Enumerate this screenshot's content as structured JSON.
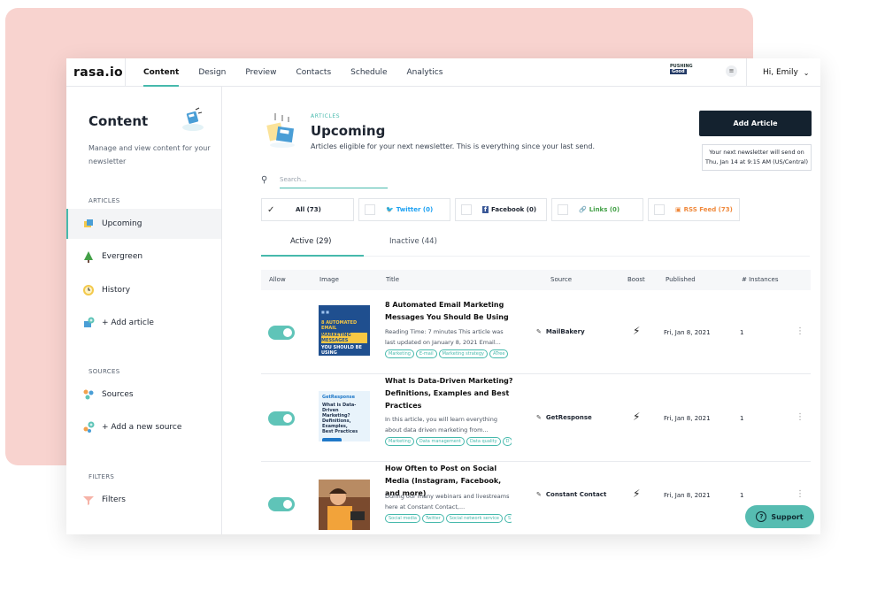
{
  "app": {
    "logo": "rasa.io",
    "nav": [
      "Content",
      "Design",
      "Preview",
      "Contacts",
      "Schedule",
      "Analytics"
    ],
    "active_nav": "Content",
    "brand_badge": {
      "line1": "PUSHING",
      "line2": "Good"
    },
    "menu_icon": "menu-dots-icon",
    "user_label": "Hi, Emily"
  },
  "sidebar": {
    "title": "Content",
    "description": "Manage and view content for your newsletter",
    "sections": {
      "articles": "ARTICLES",
      "sources": "SOURCES",
      "filters": "FILTERS"
    },
    "items": [
      {
        "label": "Upcoming",
        "icon": "upcoming-icon"
      },
      {
        "label": "Evergreen",
        "icon": "tree-icon"
      },
      {
        "label": "History",
        "icon": "history-icon"
      },
      {
        "label": "+ Add article",
        "icon": "add-article-icon"
      },
      {
        "label": "Sources",
        "icon": "sources-icon"
      },
      {
        "label": "+ Add a new source",
        "icon": "add-source-icon"
      },
      {
        "label": "Filters",
        "icon": "filter-icon"
      }
    ]
  },
  "main": {
    "eyebrow": "ARTICLES",
    "title": "Upcoming",
    "subtitle": "Articles eligible for your next newsletter. This is everything since your last send.",
    "add_button": "Add Article",
    "next_note_line1": "Your next newsletter will send on",
    "next_note_line2": "Thu, Jan 14 at 9:15 AM (US/Central)",
    "search_placeholder": "Search...",
    "channels": [
      {
        "label": "All (73)",
        "icon": "check-icon"
      },
      {
        "label": "Twitter (0)",
        "icon": "twitter-icon"
      },
      {
        "label": "Facebook (0)",
        "icon": "facebook-icon"
      },
      {
        "label": "Links (0)",
        "icon": "link-icon"
      },
      {
        "label": "RSS Feed (73)",
        "icon": "rss-icon"
      }
    ],
    "tabs": {
      "active": "Active (29)",
      "inactive": "Inactive (44)"
    },
    "columns": [
      "Allow",
      "Image",
      "Title",
      "Source",
      "Boost",
      "Published",
      "# Instances"
    ],
    "rows": [
      {
        "title": "8 Automated Email Marketing Messages You Should Be Using",
        "desc": "Reading Time: 7 minutes This article was last updated on January 8, 2021 Email...",
        "tags": [
          "Marketing",
          "E-mail",
          "Marketing strategy",
          "ATree"
        ],
        "source": "MailBakery",
        "published": "Fri, Jan 8, 2021",
        "instances": "1",
        "thumb_lines": [
          "8 AUTOMATED EMAIL",
          "MARKETING MESSAGES",
          "YOU SHOULD BE USING"
        ]
      },
      {
        "title": "What Is Data-Driven Marketing? Definitions, Examples and Best Practices",
        "desc": "In this article, you will learn everything about data driven marketing from...",
        "tags": [
          "Marketing",
          "Data management",
          "Data quality",
          "D"
        ],
        "source": "GetResponse",
        "published": "Fri, Jan 8, 2021",
        "instances": "1",
        "thumb_lines": [
          "GetResponse",
          "What is Data-Driven",
          "Marketing?",
          "Definitions, Examples,",
          "Best Practices"
        ]
      },
      {
        "title": "How Often to Post on Social Media (Instagram, Facebook, and more)",
        "desc": "During our many webinars and livestreams here at Constant Contact,...",
        "tags": [
          "Social media",
          "Twitter",
          "Social network service",
          "S"
        ],
        "source": "Constant Contact",
        "published": "Fri, Jan 8, 2021",
        "instances": "1",
        "thumb_lines": []
      }
    ]
  },
  "support": {
    "label": "Support"
  },
  "colors": {
    "accent": "#46b9ac",
    "dark_button": "#14222f",
    "backdrop": "#f8d3cf",
    "toggle": "#5fc4b8"
  }
}
